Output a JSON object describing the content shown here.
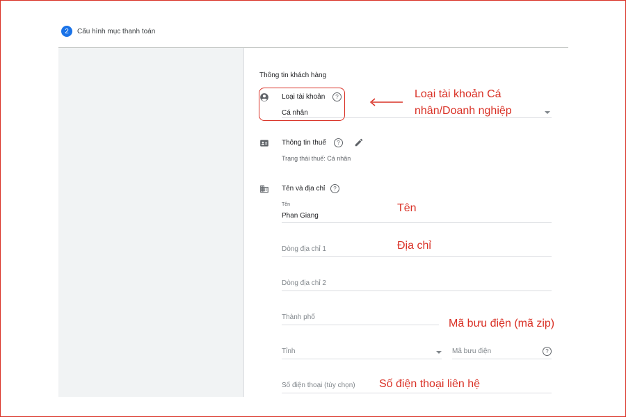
{
  "step": {
    "number": "2",
    "title": "Cấu hình mục thanh toán"
  },
  "form": {
    "section_title": "Thông tin khách hàng",
    "account_type": {
      "label": "Loại tài khoản",
      "value": "Cá nhân"
    },
    "tax_info": {
      "label": "Thông tin thuế",
      "status": "Trạng thái thuế: Cá nhân"
    },
    "name_address": {
      "label": "Tên và địa chỉ",
      "name_label": "Tên",
      "name_value": "Phan Giang",
      "address1_placeholder": "Dòng địa chỉ 1",
      "address2_placeholder": "Dòng địa chỉ 2",
      "city_placeholder": "Thành phố",
      "province_placeholder": "Tỉnh",
      "postal_placeholder": "Mã bưu điện",
      "phone_placeholder": "Số điện thoại (tùy chọn)"
    }
  },
  "annotations": {
    "account_type_line1": "Loại tài khoản Cá",
    "account_type_line2": "nhân/Doanh nghiệp",
    "name": "Tên",
    "address": "Địa chỉ",
    "postal": "Mã bưu điện (mã zip)",
    "phone": "Số điện thoại liên hệ"
  },
  "colors": {
    "accent": "#1a73e8",
    "annotation": "#d93025"
  }
}
